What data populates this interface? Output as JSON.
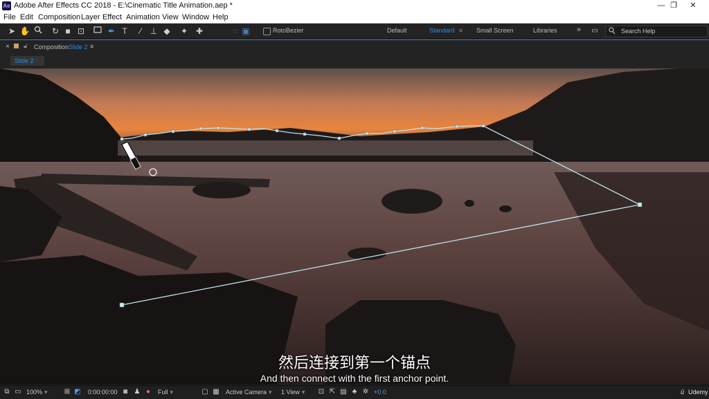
{
  "window": {
    "app_icon": "Ae",
    "title": "Adobe After Effects CC 2018 - E:\\Cinematic Title Animation.aep *",
    "minimize": "—",
    "maximize": "❐",
    "close": "✕"
  },
  "menu": [
    "File",
    "Edit",
    "Composition",
    "Layer",
    "Effect",
    "Animation",
    "View",
    "Window",
    "Help"
  ],
  "toolbar": {
    "rotobezier_label": "RotoBezier",
    "workspaces": [
      "Default",
      "Standard",
      "Small Screen",
      "Libraries"
    ],
    "active_workspace": "Standard",
    "overflow": "»",
    "search_placeholder": "Search Help"
  },
  "panel": {
    "close": "×",
    "title_prefix": "Composition",
    "comp_name": "Slide 2",
    "menu_icon": "≡",
    "tab_label": "Slide 2"
  },
  "subtitles": {
    "chinese": "然后连接到第一个锚点",
    "english": "And then connect with the first anchor point."
  },
  "statusbar": {
    "zoom": "100%",
    "timecode": "0:00:00:00",
    "resolution": "Full",
    "camera": "Active Camera",
    "views": "1 View",
    "exposure": "+0.0",
    "watermark": "Udemy"
  },
  "colors": {
    "accent": "#2d8ceb",
    "mask_path": "#bfe3ea"
  }
}
